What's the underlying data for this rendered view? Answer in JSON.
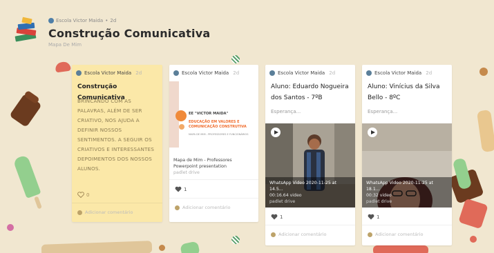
{
  "header": {
    "author": "Escola Victor Maida",
    "time": "2d",
    "title": "Construção Comunicativa",
    "subtitle": "Mapa De Mim"
  },
  "cards": [
    {
      "author": "Escola Victor Maida",
      "time": "2d",
      "title": "Construção Comunicativa",
      "body_lines": [
        "BRINCANDO COM AS",
        "PALAVRAS, ALÉM DE SER",
        "CRIATIVO, NOS AJUDA A",
        "DEFINIR NOSSOS",
        "SENTIMENTOS. A SEGUIR OS",
        "CRIATIVOS E INTERESSANTES",
        "DEPOIMENTOS DOS NOSSOS",
        "ALUNOS."
      ],
      "likes": "0",
      "comment_placeholder": "Adicionar comentário"
    },
    {
      "author": "Escola Victor Maida",
      "time": "2d",
      "thumb": {
        "line1": "EE \"VICTOR MAIDA\"",
        "line2": "EDUCAÇÃO EM VALORES E COMUNICAÇÃO CONSTRUTIVA",
        "line3": "MAPA DE MIM - PROFESSORES E FUNCIONÁRIOS"
      },
      "file_title": "Mapa de Mim - Professores",
      "file_type": "Powerpoint presentation",
      "source": "padlet drive",
      "likes": "1",
      "comment_placeholder": "Adicionar comentário"
    },
    {
      "author": "Escola Victor Maida",
      "time": "2d",
      "title_lines": [
        "Aluno: Eduardo Nogueira",
        "dos Santos - 7ºB"
      ],
      "note": "Esperança...",
      "video_title": "WhatsApp Video 2020-11-25 at 14.5...",
      "video_meta": "00:16.64 video",
      "source": "padlet drive",
      "likes": "1",
      "comment_placeholder": "Adicionar comentário"
    },
    {
      "author": "Escola Victor Maida",
      "time": "2d",
      "title_lines": [
        "Aluno: Vinícius da Silva",
        "Bello - 8ºC"
      ],
      "note": "Esperança...",
      "video_title": "WhatsApp Video 2020-11-25 at 18.1...",
      "video_meta": "00:32 video",
      "source": "padlet drive",
      "likes": "1",
      "comment_placeholder": "Adicionar comentário"
    }
  ],
  "colors": {
    "background": "#f1e7d0",
    "note_yellow": "#fbe8a8",
    "card_white": "#ffffff"
  }
}
